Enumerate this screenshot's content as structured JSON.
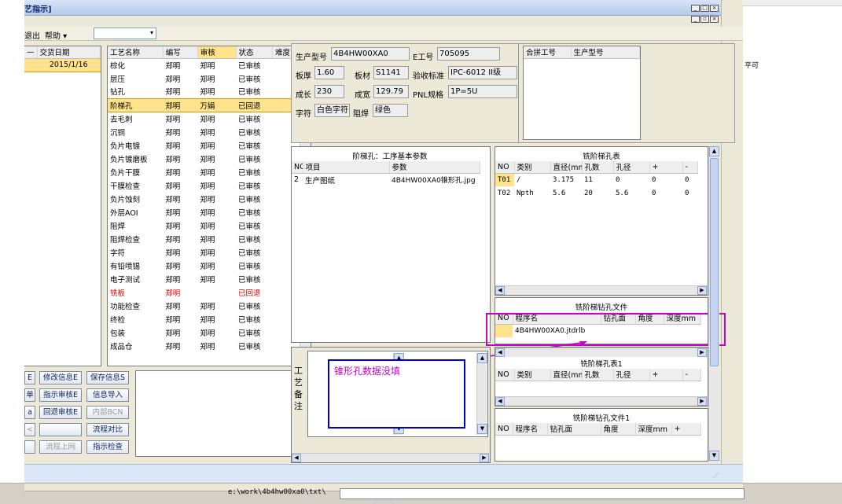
{
  "window": {
    "title": "艺指示]",
    "controls": [
      "_",
      "□",
      "×"
    ]
  },
  "menu": {
    "exit": "退出",
    "help": "帮助 ▾"
  },
  "left_list": {
    "headers": [
      "—",
      "交货日期"
    ],
    "row": {
      "date": "2015/1/16"
    }
  },
  "process_table": {
    "headers": [
      "工艺名称",
      "编写",
      "审核",
      "状态",
      "难度"
    ],
    "rows": [
      {
        "name": "棕化",
        "writer": "郑明",
        "reviewer": "郑明",
        "status": "已审核",
        "difficulty": ""
      },
      {
        "name": "层压",
        "writer": "郑明",
        "reviewer": "郑明",
        "status": "已审核",
        "difficulty": ""
      },
      {
        "name": "钻孔",
        "writer": "郑明",
        "reviewer": "郑明",
        "status": "已审核",
        "difficulty": ""
      },
      {
        "name": "阶梯孔",
        "writer": "郑明",
        "reviewer": "万娟",
        "status": "已回退",
        "difficulty": ""
      },
      {
        "name": "去毛刺",
        "writer": "郑明",
        "reviewer": "郑明",
        "status": "已审核",
        "difficulty": ""
      },
      {
        "name": "沉铜",
        "writer": "郑明",
        "reviewer": "郑明",
        "status": "已审核",
        "difficulty": ""
      },
      {
        "name": "负片电镀",
        "writer": "郑明",
        "reviewer": "郑明",
        "status": "已审核",
        "difficulty": ""
      },
      {
        "name": "负片镀磨板",
        "writer": "郑明",
        "reviewer": "郑明",
        "status": "已审核",
        "difficulty": ""
      },
      {
        "name": "负片干膜",
        "writer": "郑明",
        "reviewer": "郑明",
        "status": "已审核",
        "difficulty": ""
      },
      {
        "name": "干膜检查",
        "writer": "郑明",
        "reviewer": "郑明",
        "status": "已审核",
        "difficulty": ""
      },
      {
        "name": "负片蚀刻",
        "writer": "郑明",
        "reviewer": "郑明",
        "status": "已审核",
        "difficulty": ""
      },
      {
        "name": "外层AOI",
        "writer": "郑明",
        "reviewer": "郑明",
        "status": "已审核",
        "difficulty": ""
      },
      {
        "name": "阻焊",
        "writer": "郑明",
        "reviewer": "郑明",
        "status": "已审核",
        "difficulty": ""
      },
      {
        "name": "阻焊检查",
        "writer": "郑明",
        "reviewer": "郑明",
        "status": "已审核",
        "difficulty": ""
      },
      {
        "name": "字符",
        "writer": "郑明",
        "reviewer": "郑明",
        "status": "已审核",
        "difficulty": ""
      },
      {
        "name": "有铅喷锡",
        "writer": "郑明",
        "reviewer": "郑明",
        "status": "已审核",
        "difficulty": ""
      },
      {
        "name": "电子测试",
        "writer": "郑明",
        "reviewer": "郑明",
        "status": "已审核",
        "difficulty": ""
      },
      {
        "name": "铣板",
        "writer": "郑明",
        "reviewer": "",
        "status": "已回退",
        "difficulty": ""
      },
      {
        "name": "功能检查",
        "writer": "郑明",
        "reviewer": "郑明",
        "status": "已审核",
        "difficulty": ""
      },
      {
        "name": "终检",
        "writer": "郑明",
        "reviewer": "郑明",
        "status": "已审核",
        "difficulty": ""
      },
      {
        "name": "包装",
        "writer": "郑明",
        "reviewer": "郑明",
        "status": "已审核",
        "difficulty": ""
      },
      {
        "name": "成品仓",
        "writer": "郑明",
        "reviewer": "郑明",
        "status": "已审核",
        "difficulty": ""
      }
    ]
  },
  "buttons": {
    "b1": "E",
    "b2": "修改信息E",
    "b3": "保存信息S",
    "b4": "单",
    "b5": "指示审核E",
    "b6": "信息导入",
    "b7": "a",
    "b8": "回退审核E",
    "b9": "内部BCN",
    "b10": "<",
    "b11": "",
    "b12": "流程对比",
    "b13": "",
    "b14": "流程上网",
    "b15": "指示检查"
  },
  "product": {
    "model_label": "生产型号",
    "model": "4B4HW00XA0",
    "eno_label": "E工号",
    "eno": "705095",
    "thickness_label": "板厚",
    "thickness": "1.60",
    "material_label": "板材",
    "material": "S1141",
    "standard_label": "验收标准",
    "standard": "IPC-6012 II级",
    "length_label": "成长",
    "length": "230",
    "width_label": "成宽",
    "width": "129.79",
    "pnl_label": "PNL规格",
    "pnl": "1P=5U",
    "char_label": "字符",
    "char": "白色字符",
    "mask_label": "阻焊",
    "mask": "绿色"
  },
  "merge": {
    "h1": "合拼工号",
    "h2": "生产型号"
  },
  "params": {
    "title": "阶梯孔：工序基本参数",
    "headers": [
      "NO",
      "项目",
      "参数"
    ],
    "rows": [
      {
        "no": "2",
        "item": "生产图纸",
        "value": "4B4HW00XA0锥形孔.jpg"
      }
    ]
  },
  "milling_table": {
    "title": "铣阶梯孔表",
    "headers": [
      "NO",
      "类别",
      "直径(mm)",
      "孔数",
      "孔径",
      "+",
      "-"
    ],
    "rows": [
      {
        "no": "T01",
        "type": "/",
        "dia": "3.175",
        "count": "11",
        "hole": "0",
        "plus": "0",
        "minus": "0"
      },
      {
        "no": "T02",
        "type": "Npth",
        "dia": "5.6",
        "count": "20",
        "hole": "5.6",
        "plus": "0",
        "minus": "0"
      }
    ]
  },
  "drill_file": {
    "title": "铣阶梯钻孔文件",
    "headers": [
      "NO",
      "程序名",
      "钻孔面",
      "角度",
      "深度mm"
    ],
    "rows": [
      {
        "no": "",
        "name": "4B4HW00XA0.jtdrlb",
        "face": "",
        "angle": "",
        "depth": ""
      }
    ]
  },
  "milling_table1": {
    "title": "铣阶梯孔表1",
    "headers": [
      "NO",
      "类别",
      "直径(mm)",
      "孔数",
      "孔径",
      "+",
      "-"
    ]
  },
  "drill_file1": {
    "title": "铣阶梯钻孔文件1",
    "headers": [
      "NO",
      "程序名",
      "钻孔面",
      "角度",
      "深度mm",
      "+"
    ]
  },
  "remarks": {
    "label": "工艺备注",
    "note": "锥形孔数据没填"
  },
  "right_stub": {
    "text": "平可"
  },
  "taskbar": {
    "path": "e:\\work\\4b4hw00xa0\\txt\\"
  },
  "colors": {
    "annotation": "#cc00cc",
    "note_border": "#0000cc",
    "selected_row": "#ffe28c"
  }
}
